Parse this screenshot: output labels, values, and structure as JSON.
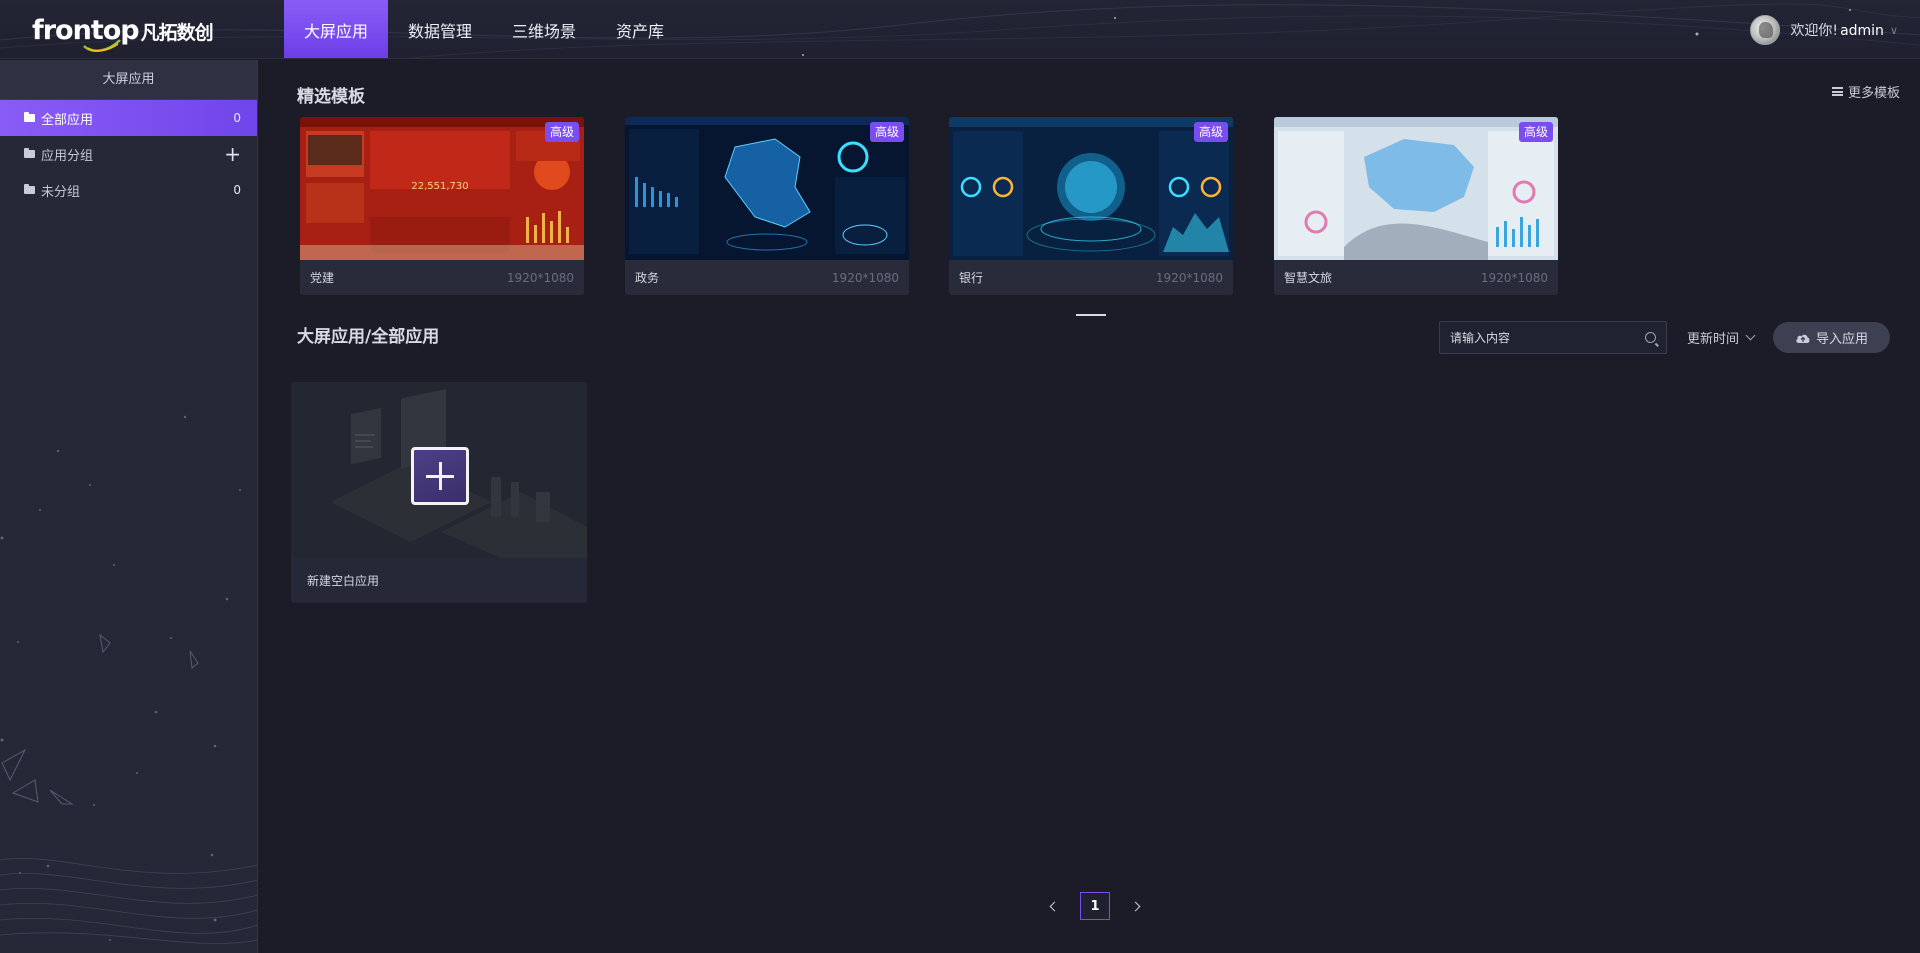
{
  "brand": {
    "logo_text": "frontop",
    "logo_cn": "凡拓数创"
  },
  "nav": {
    "items": [
      {
        "label": "大屏应用",
        "active": true
      },
      {
        "label": "数据管理",
        "active": false
      },
      {
        "label": "三维场景",
        "active": false
      },
      {
        "label": "资产库",
        "active": false
      }
    ]
  },
  "user": {
    "welcome": "欢迎你!",
    "name": "admin"
  },
  "sidebar": {
    "title": "大屏应用",
    "items": [
      {
        "label": "全部应用",
        "count": "0",
        "active": true
      },
      {
        "label": "应用分组",
        "action": "+"
      },
      {
        "label": "未分组",
        "count": "0"
      }
    ]
  },
  "templates": {
    "title": "精选模板",
    "more_label": "更多模板",
    "cards": [
      {
        "name": "党建",
        "size": "1920*1080",
        "badge": "高级",
        "theme": "#b8261b"
      },
      {
        "name": "政务",
        "size": "1920*1080",
        "badge": "高级",
        "theme": "#0a1b3a"
      },
      {
        "name": "银行",
        "size": "1920*1080",
        "badge": "高级",
        "theme": "#0b2b4e"
      },
      {
        "name": "智慧文旅",
        "size": "1920*1080",
        "badge": "高级",
        "theme": "#c9d8e6"
      }
    ]
  },
  "apps": {
    "title": "大屏应用/全部应用",
    "search_placeholder": "请输入内容",
    "sort_label": "更新时间",
    "import_label": "导入应用",
    "new_app_label": "新建空白应用"
  },
  "pagination": {
    "current": "1"
  },
  "colors": {
    "accent": "#7b4cf0",
    "background": "#1b1c28",
    "sidebar": "#262838"
  }
}
